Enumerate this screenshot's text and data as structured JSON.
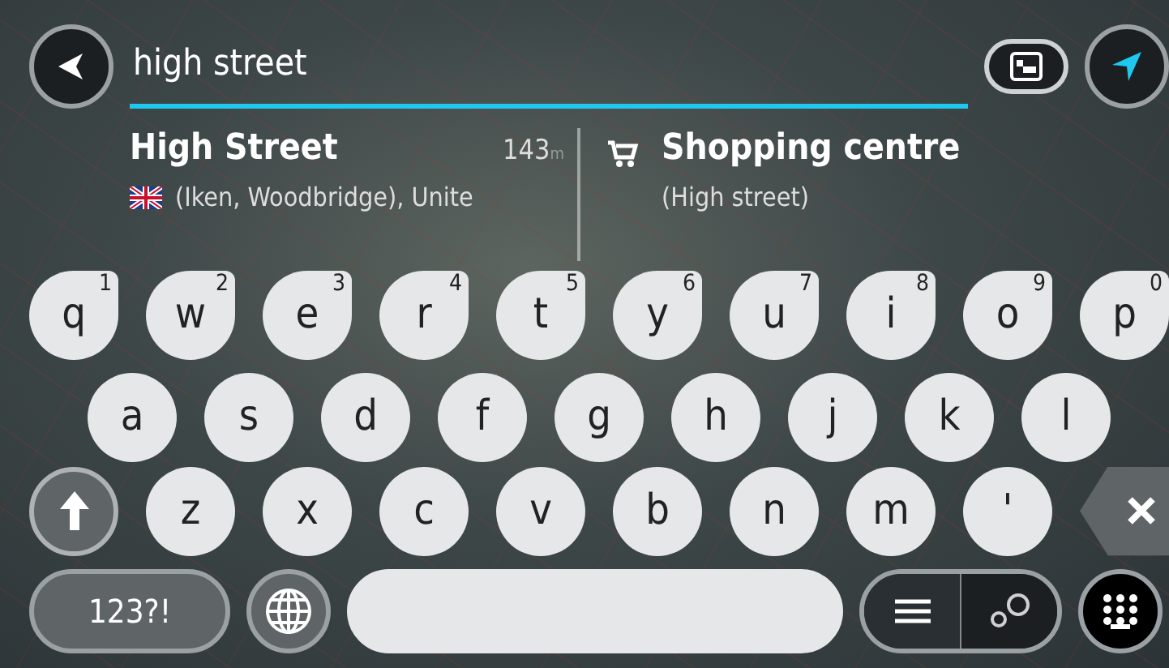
{
  "search": {
    "value": "high street"
  },
  "results": [
    {
      "kind": "address",
      "title": "High Street",
      "distance": "143",
      "unit": "m",
      "subtitle": "(Iken, Woodbridge), Unite"
    },
    {
      "kind": "category",
      "title": "Shopping centre",
      "subtitle": "(High street)"
    }
  ],
  "keyboard": {
    "rows": [
      [
        {
          "key": "q",
          "hint": "1"
        },
        {
          "key": "w",
          "hint": "2"
        },
        {
          "key": "e",
          "hint": "3"
        },
        {
          "key": "r",
          "hint": "4"
        },
        {
          "key": "t",
          "hint": "5"
        },
        {
          "key": "y",
          "hint": "6"
        },
        {
          "key": "u",
          "hint": "7"
        },
        {
          "key": "i",
          "hint": "8"
        },
        {
          "key": "o",
          "hint": "9"
        },
        {
          "key": "p",
          "hint": "0"
        }
      ],
      [
        {
          "key": "a"
        },
        {
          "key": "s"
        },
        {
          "key": "d"
        },
        {
          "key": "f"
        },
        {
          "key": "g"
        },
        {
          "key": "h"
        },
        {
          "key": "j"
        },
        {
          "key": "k"
        },
        {
          "key": "l"
        }
      ],
      [
        {
          "key": "z"
        },
        {
          "key": "x"
        },
        {
          "key": "c"
        },
        {
          "key": "v"
        },
        {
          "key": "b"
        },
        {
          "key": "n"
        },
        {
          "key": "m"
        },
        {
          "key": "'"
        }
      ]
    ],
    "mode_key": "123?!",
    "result_view": [
      {
        "kind": "list",
        "selected": true
      },
      {
        "kind": "map",
        "selected": false
      }
    ]
  }
}
